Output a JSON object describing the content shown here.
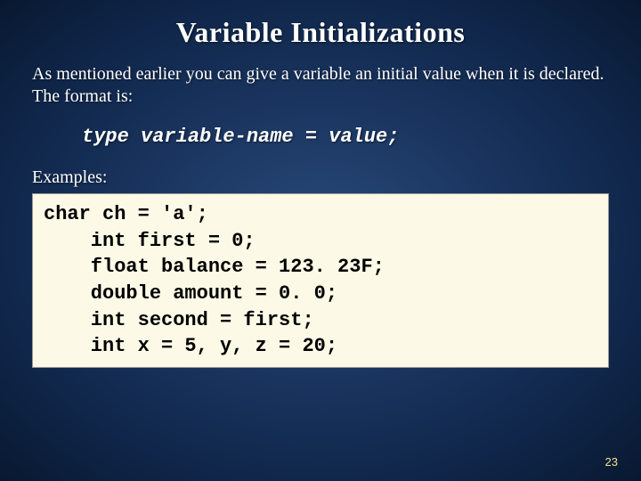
{
  "slide": {
    "title": "Variable Initializations",
    "intro": "As mentioned earlier you can give a variable an initial value when it is declared.  The format is:",
    "format": "type variable-name = value;",
    "examples_label": "Examples:",
    "code_lines": [
      "char ch = 'a';",
      "    int first = 0;",
      "    float balance = 123. 23F;",
      "    double amount = 0. 0;",
      "    int second = first;",
      "    int x = 5, y, z = 20;"
    ],
    "page_number": "23"
  }
}
